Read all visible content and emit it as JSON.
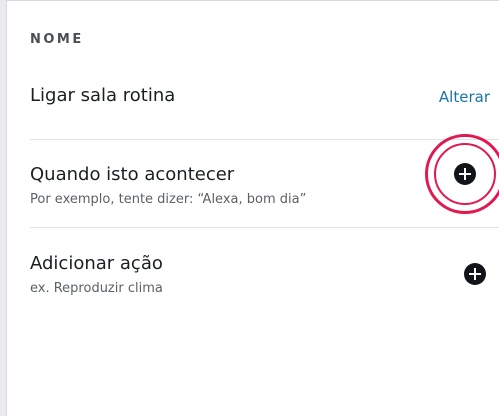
{
  "section": {
    "label": "NOME"
  },
  "routine": {
    "name": "Ligar sala rotina",
    "change_label": "Alterar"
  },
  "trigger": {
    "title": "Quando isto acontecer",
    "subtitle": "Por exemplo, tente dizer: “Alexa, bom dia”",
    "add_icon": "plus-circle-icon"
  },
  "action": {
    "title": "Adicionar ação",
    "subtitle": "ex. Reproduzir clima",
    "add_icon": "plus-circle-icon"
  },
  "colors": {
    "link": "#1a73a8",
    "highlight": "#e0194f",
    "icon": "#111418"
  }
}
